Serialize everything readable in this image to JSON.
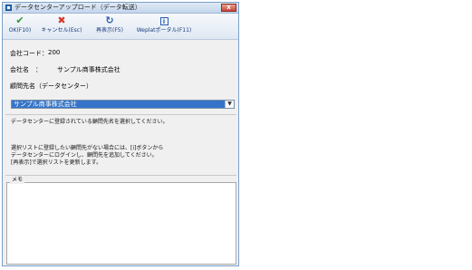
{
  "window": {
    "title": "データセンターアップロード（データ転送）",
    "close_label": "x"
  },
  "toolbar": {
    "buttons": [
      {
        "label": "OK(F10)",
        "icon": "✔"
      },
      {
        "label": "キャンセル(Esc)",
        "icon": "✖"
      },
      {
        "label": "再表示(F5)",
        "icon": "↻"
      },
      {
        "label": "Weplatポータル(F11)",
        "icon": "i"
      }
    ]
  },
  "form": {
    "company_code_label": "会社コード：",
    "company_code_value": "200",
    "company_name_label": "会社名　：",
    "company_name_value": "サンプル商事株式会社",
    "advisor_label": "顧問先名（データセンター）",
    "advisor_selected": "サンプル商事株式会社"
  },
  "info": {
    "line1": "データセンターに登録されている顧問先名を選択してください。",
    "line2": "選択リストに登録したい顧問先がない場合には、[i]ボタンから",
    "line3": "データセンターにログインし、顧問先を追加してください。",
    "line4": "[再表示]で選択リストを更新します。"
  },
  "memo": {
    "label": "メモ",
    "value": ""
  },
  "colors": {
    "selection": "#3574c8",
    "ok_icon": "#2f9a2f",
    "cancel_icon": "#d23a2a",
    "toolbar_text": "#1a3d7a"
  }
}
